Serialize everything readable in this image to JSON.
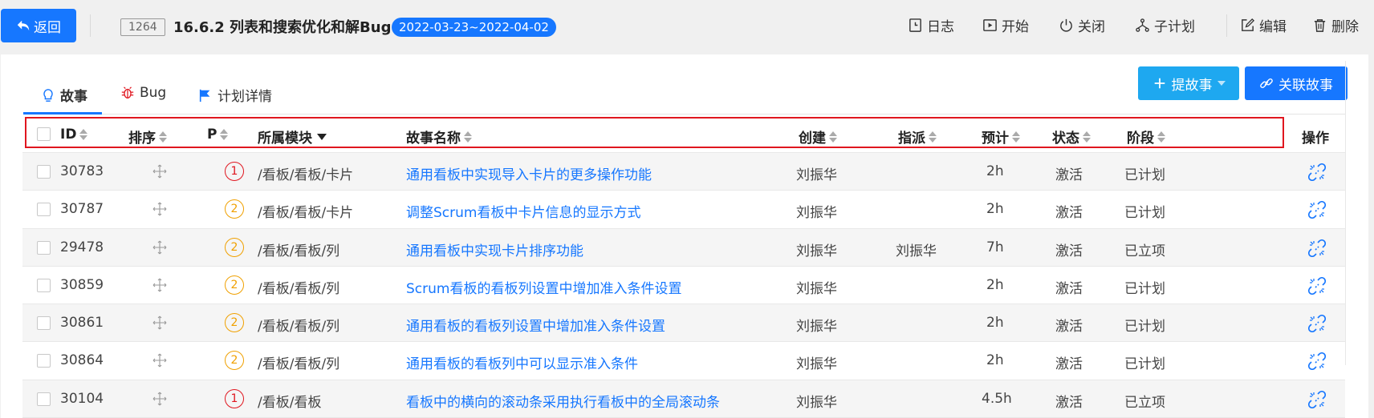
{
  "topbar": {
    "back_label": "返回",
    "plan_id": "1264",
    "plan_title": "16.6.2 列表和搜索优化和解Bug",
    "date_range": "2022-03-23~2022-04-02",
    "actions": {
      "log": "日志",
      "start": "开始",
      "close": "关闭",
      "subplan": "子计划",
      "edit": "编辑",
      "delete": "删除"
    }
  },
  "tabs": {
    "story": "故事",
    "bug": "Bug",
    "plan_detail": "计划详情"
  },
  "buttons": {
    "add_story": "提故事",
    "link_story": "关联故事"
  },
  "colors": {
    "primary": "#1677ff",
    "primary_light": "#1ea8f0",
    "highlight_box": "#e0161f",
    "priority_1": "#e0161f",
    "priority_2": "#f0a000"
  },
  "table": {
    "columns": {
      "id": "ID",
      "order": "排序",
      "priority": "P",
      "module": "所属模块",
      "name": "故事名称",
      "creator": "创建",
      "assignee": "指派",
      "estimate": "预计",
      "status": "状态",
      "stage": "阶段",
      "actions": "操作"
    },
    "sorted_column": "所属模块",
    "rows": [
      {
        "id": "30783",
        "priority": "1",
        "module": "/看板/看板/卡片",
        "name": "通用看板中实现导入卡片的更多操作功能",
        "creator": "刘振华",
        "assignee": "",
        "estimate": "2h",
        "status": "激活",
        "stage": "已计划"
      },
      {
        "id": "30787",
        "priority": "2",
        "module": "/看板/看板/卡片",
        "name": "调整Scrum看板中卡片信息的显示方式",
        "creator": "刘振华",
        "assignee": "",
        "estimate": "2h",
        "status": "激活",
        "stage": "已计划"
      },
      {
        "id": "29478",
        "priority": "2",
        "module": "/看板/看板/列",
        "name": "通用看板中实现卡片排序功能",
        "creator": "刘振华",
        "assignee": "刘振华",
        "estimate": "7h",
        "status": "激活",
        "stage": "已立项"
      },
      {
        "id": "30859",
        "priority": "2",
        "module": "/看板/看板/列",
        "name": "Scrum看板的看板列设置中增加准入条件设置",
        "creator": "刘振华",
        "assignee": "",
        "estimate": "2h",
        "status": "激活",
        "stage": "已计划"
      },
      {
        "id": "30861",
        "priority": "2",
        "module": "/看板/看板/列",
        "name": "通用看板的看板列设置中增加准入条件设置",
        "creator": "刘振华",
        "assignee": "",
        "estimate": "2h",
        "status": "激活",
        "stage": "已计划"
      },
      {
        "id": "30864",
        "priority": "2",
        "module": "/看板/看板/列",
        "name": "通用看板的看板列中可以显示准入条件",
        "creator": "刘振华",
        "assignee": "",
        "estimate": "2h",
        "status": "激活",
        "stage": "已计划"
      },
      {
        "id": "30104",
        "priority": "1",
        "module": "/看板/看板",
        "name": "看板中的横向的滚动条采用执行看板中的全局滚动条",
        "creator": "刘振华",
        "assignee": "",
        "estimate": "4.5h",
        "status": "激活",
        "stage": "已立项"
      }
    ]
  }
}
